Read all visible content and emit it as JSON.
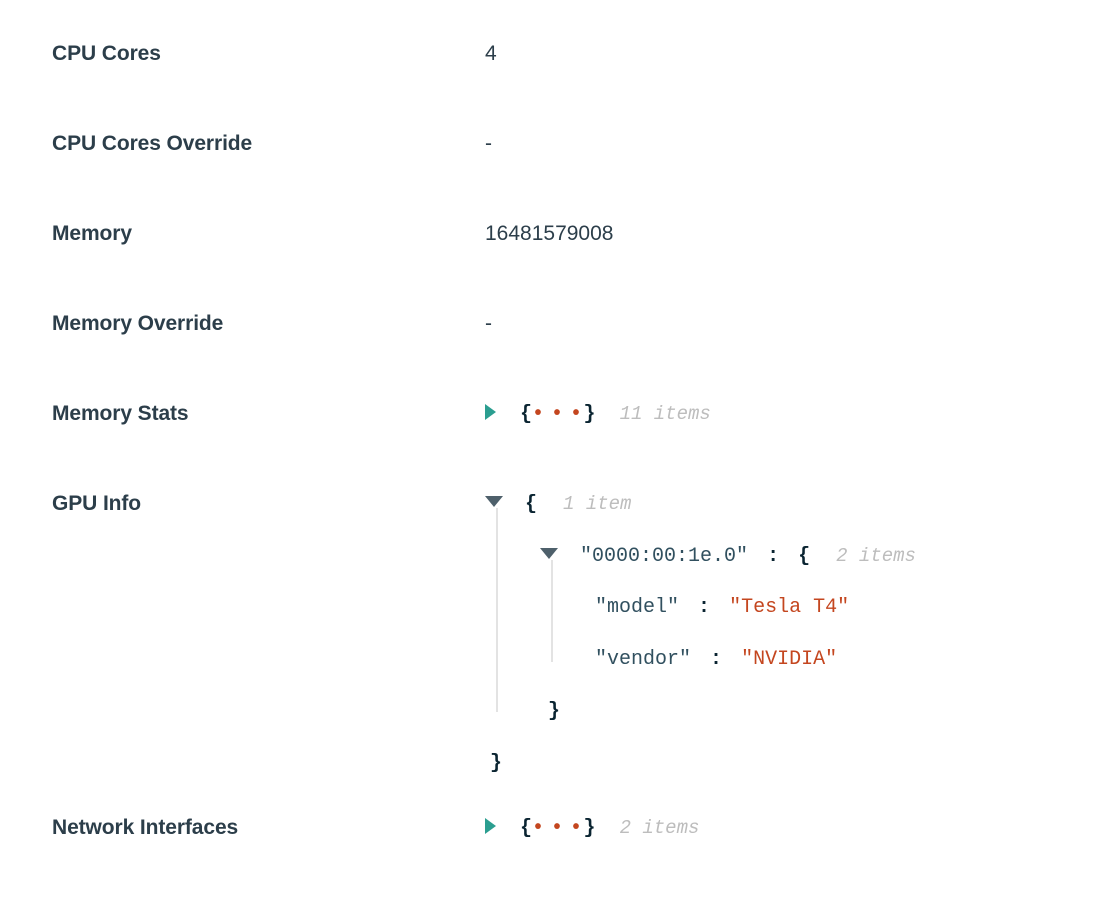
{
  "page": {
    "background": "#ffffff",
    "label_color": "#2c3e4a",
    "value_color": "#2c3e4a",
    "accent_collapsed_caret": "#2b9e90",
    "accent_expanded_caret": "#4e606b",
    "string_color": "#c4461f",
    "key_color": "#31505f",
    "brace_color": "#0a2431",
    "count_color": "#bdbdbd",
    "guide_color": "#e3e3e3"
  },
  "rows": [
    {
      "label": "CPU Cores",
      "value": "4"
    },
    {
      "label": "CPU Cores Override",
      "value": "-"
    },
    {
      "label": "Memory",
      "value": "16481579008"
    },
    {
      "label": "Memory Override",
      "value": "-"
    },
    {
      "label": "Memory Stats",
      "value": ""
    },
    {
      "label": "GPU Info",
      "value": ""
    },
    {
      "label": "Network Interfaces",
      "value": ""
    }
  ],
  "memory_stats": {
    "label": "Memory Stats",
    "state": "collapsed",
    "open_brace": "{",
    "ellipsis": "• • •",
    "close_brace": "}",
    "count": "11 items"
  },
  "gpu_info": {
    "label": "GPU Info",
    "state": "expanded",
    "open_brace": "{",
    "count": "1 item",
    "close_brace": "}",
    "child": {
      "state": "expanded",
      "key": "\"0000:00:1e.0\"",
      "colon": ":",
      "open_brace": "{",
      "count": "2 items",
      "close_brace": "}",
      "entries": [
        {
          "key": "\"model\"",
          "colon": ":",
          "value": "\"Tesla T4\""
        },
        {
          "key": "\"vendor\"",
          "colon": ":",
          "value": "\"NVIDIA\""
        }
      ]
    }
  },
  "network_interfaces": {
    "label": "Network Interfaces",
    "state": "collapsed",
    "open_brace": "{",
    "ellipsis": "• • •",
    "close_brace": "}",
    "count": "2 items"
  }
}
